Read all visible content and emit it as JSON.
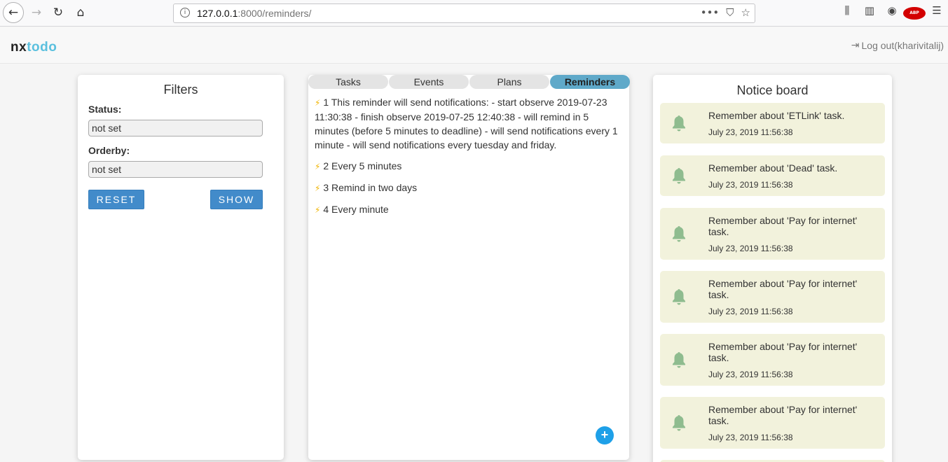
{
  "browser": {
    "url_host": "127.0.0.1",
    "url_path": ":8000/reminders/",
    "abp_label": "ABP"
  },
  "header": {
    "logo_part1": "nx",
    "logo_part2": "todo",
    "logout": "Log out(kharivitalij)"
  },
  "filters": {
    "title": "Filters",
    "status_label": "Status:",
    "status_value": "not set",
    "orderby_label": "Orderby:",
    "orderby_value": "not set",
    "reset": "RESET",
    "show": "SHOW"
  },
  "tabs": [
    {
      "label": "Tasks",
      "active": false
    },
    {
      "label": "Events",
      "active": false
    },
    {
      "label": "Plans",
      "active": false
    },
    {
      "label": "Reminders",
      "active": true
    }
  ],
  "reminders": [
    "1 This reminder will send notifications: - start observe 2019-07-23 11:30:38 - finish observe 2019-07-25 12:40:38 - will remind in 5 minutes (before 5 minutes to deadline) - will send notifications every 1 minute - will send notifications every tuesday and friday.",
    "2 Every 5 minutes",
    "3 Remind in two days",
    "4 Every minute"
  ],
  "add_button": "+",
  "notice_board": {
    "title": "Notice board",
    "items": [
      {
        "message": "Remember about 'ETLink' task.",
        "date": "July 23, 2019 11:56:38"
      },
      {
        "message": "Remember about 'Dead' task.",
        "date": "July 23, 2019 11:56:38"
      },
      {
        "message": "Remember about 'Pay for internet' task.",
        "date": "July 23, 2019 11:56:38"
      },
      {
        "message": "Remember about 'Pay for internet' task.",
        "date": "July 23, 2019 11:56:38"
      },
      {
        "message": "Remember about 'Pay for internet' task.",
        "date": "July 23, 2019 11:56:38"
      },
      {
        "message": "Remember about 'Pay for internet' task.",
        "date": "July 23, 2019 11:56:38"
      }
    ]
  },
  "colors": {
    "accent": "#428bca",
    "active_tab": "#5fa9c9",
    "notice_bg": "#f2f2dc",
    "bell": "#8fbc8f",
    "logo_accent": "#5bc0de"
  }
}
